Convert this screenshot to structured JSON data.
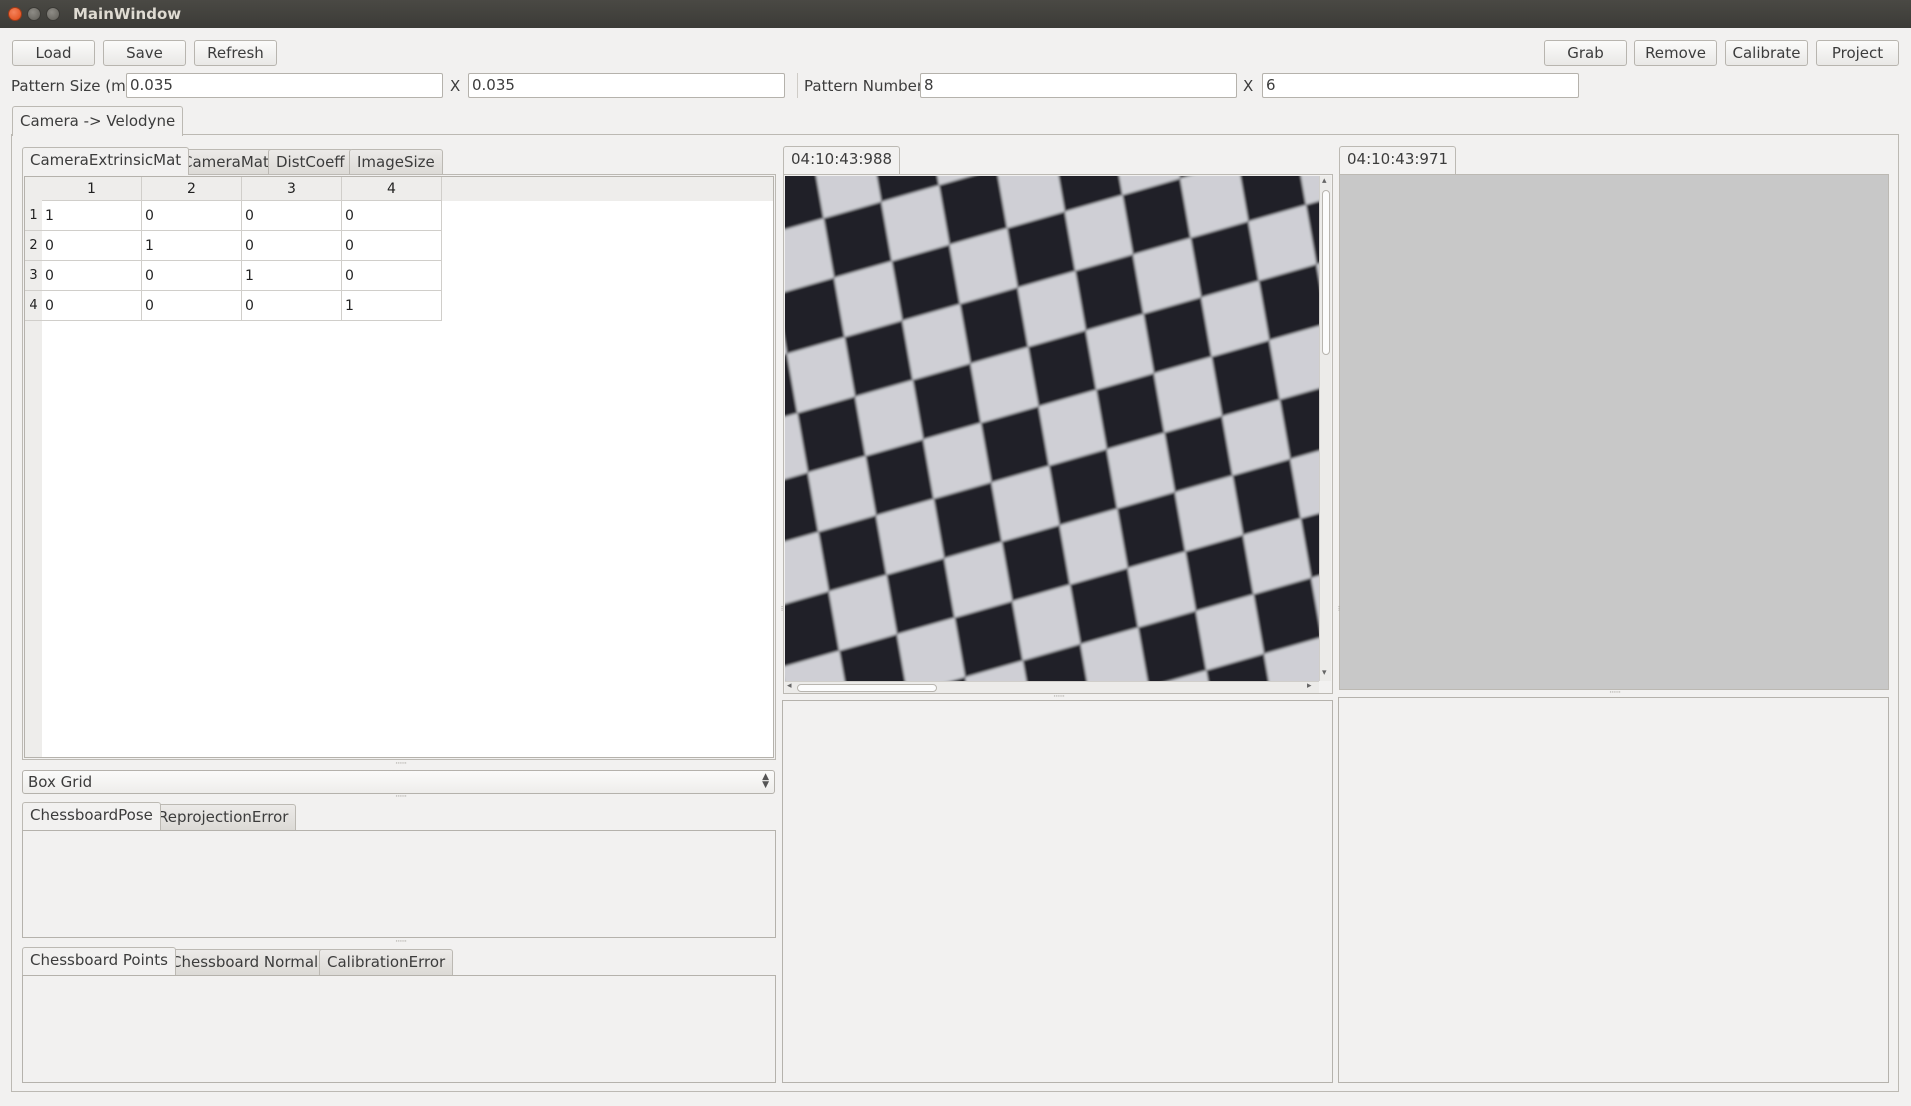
{
  "window": {
    "title": "MainWindow"
  },
  "toolbar": {
    "load": "Load",
    "save": "Save",
    "refresh": "Refresh",
    "grab": "Grab",
    "remove": "Remove",
    "calibrate": "Calibrate",
    "project": "Project"
  },
  "pattern": {
    "size_label": "Pattern Size (m)",
    "size_x": "0.035",
    "size_sep": "X",
    "size_y": "0.035",
    "number_label": "Pattern Number",
    "number_x": "8",
    "number_sep": "X",
    "number_y": "6"
  },
  "main_tab": {
    "label": "Camera -> Velodyne"
  },
  "matrix_tabs": [
    "CameraExtrinsicMat",
    "CameraMat",
    "DistCoeff",
    "ImageSize"
  ],
  "matrix": {
    "col_headers": [
      "1",
      "2",
      "3",
      "4"
    ],
    "row_headers": [
      "1",
      "2",
      "3",
      "4"
    ],
    "rows": [
      [
        "1",
        "0",
        "0",
        "0"
      ],
      [
        "0",
        "1",
        "0",
        "0"
      ],
      [
        "0",
        "0",
        "1",
        "0"
      ],
      [
        "0",
        "0",
        "0",
        "1"
      ]
    ]
  },
  "view_combo": {
    "value": "Box Grid"
  },
  "pose_tabs": [
    "ChessboardPose",
    "ReprojectionError"
  ],
  "points_tabs": [
    "Chessboard Points",
    "Chessboard Normals",
    "CalibrationError"
  ],
  "camera_view": {
    "timestamp": "04:10:43:988"
  },
  "lidar_view": {
    "timestamp": "04:10:43:971"
  }
}
